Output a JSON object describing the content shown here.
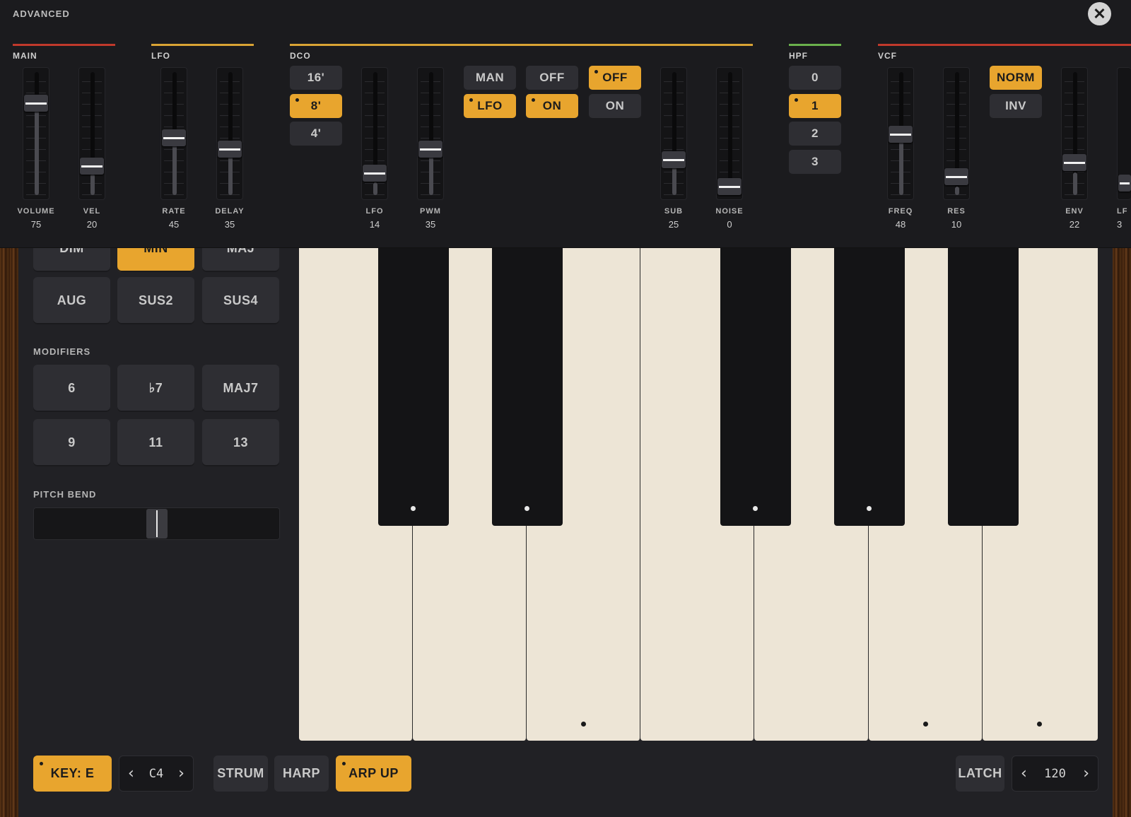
{
  "advanced": {
    "title": "ADVANCED",
    "close_glyph": "✕",
    "groups": {
      "main": "MAIN",
      "lfo": "LFO",
      "dco": "DCO",
      "hpf": "HPF",
      "vcf": "VCF"
    },
    "colors": {
      "main": "#c0392b",
      "lfo": "#d9a334",
      "dco": "#d9a334",
      "hpf": "#6ab04c",
      "vcf": "#c0392b"
    },
    "sliders": {
      "volume": {
        "label": "VOLUME",
        "value": "75"
      },
      "vel": {
        "label": "VEL",
        "value": "20"
      },
      "rate": {
        "label": "RATE",
        "value": "45"
      },
      "delay": {
        "label": "DELAY",
        "value": "35"
      },
      "lfo": {
        "label": "LFO",
        "value": "14"
      },
      "pwm": {
        "label": "PWM",
        "value": "35"
      },
      "sub": {
        "label": "SUB",
        "value": "25"
      },
      "noise": {
        "label": "NOISE",
        "value": "0"
      },
      "freq": {
        "label": "FREQ",
        "value": "48"
      },
      "res": {
        "label": "RES",
        "value": "10"
      },
      "env": {
        "label": "ENV",
        "value": "22"
      },
      "lf": {
        "label": "LF",
        "value": "3"
      }
    },
    "dco_range": [
      "16'",
      "8'",
      "4'"
    ],
    "dco_range_selected": "8'",
    "pwm_mode": [
      "MAN",
      "LFO"
    ],
    "pwm_mode_selected": "LFO",
    "toggle_a": [
      "OFF",
      "ON"
    ],
    "toggle_a_selected": "ON",
    "toggle_b": [
      "OFF",
      "ON"
    ],
    "toggle_b_selected": "OFF",
    "hpf": [
      "0",
      "1",
      "2",
      "3"
    ],
    "hpf_selected": "1",
    "env_polarity": [
      "NORM",
      "INV"
    ],
    "env_polarity_selected": "NORM"
  },
  "chords": {
    "row1": [
      "DIM",
      "MIN",
      "MAJ"
    ],
    "row1_selected": "MIN",
    "row2": [
      "AUG",
      "SUS2",
      "SUS4"
    ]
  },
  "modifiers": {
    "label": "MODIFIERS",
    "row1": [
      "6",
      "♭7",
      "MAJ7"
    ],
    "row2": [
      "9",
      "11",
      "13"
    ]
  },
  "pitch_bend": {
    "label": "PITCH BEND",
    "value": 0.5
  },
  "bottom": {
    "key": "KEY: E",
    "octave": "C4",
    "strum": "STRUM",
    "harp": "HARP",
    "arp": "ARP UP",
    "latch": "LATCH",
    "bpm": "120",
    "prev_glyph": "‹",
    "next_glyph": "›"
  }
}
